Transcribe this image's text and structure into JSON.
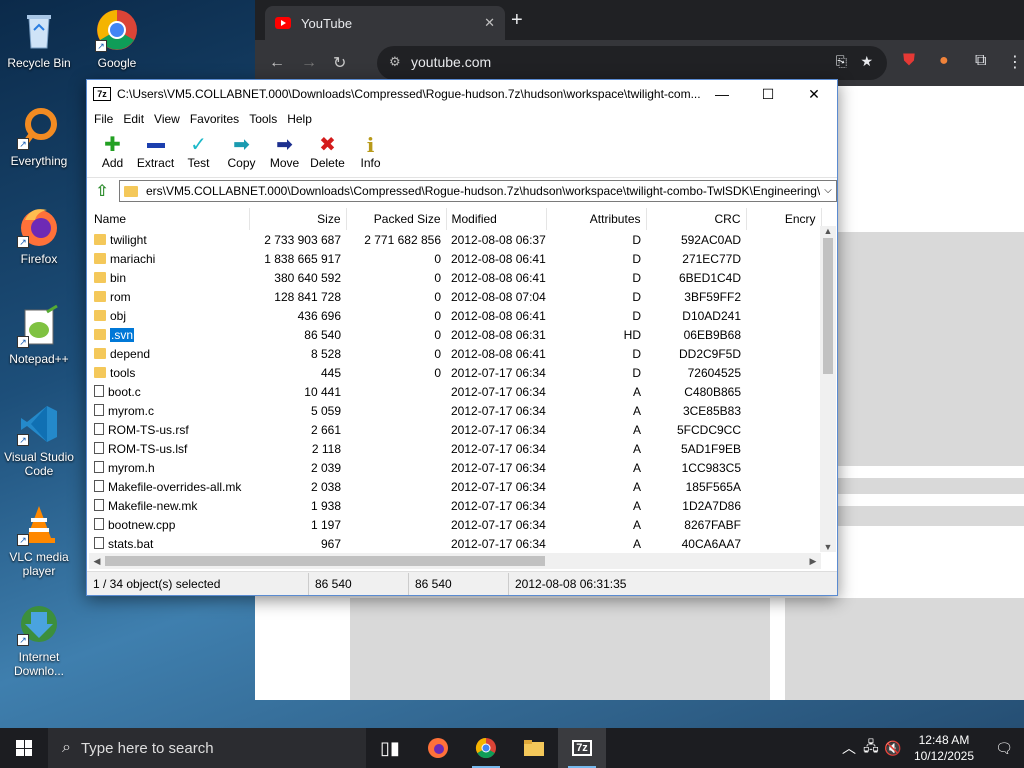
{
  "desktop": {
    "icons": [
      {
        "label": "Recycle Bin",
        "icon": "recycle-bin-icon"
      },
      {
        "label": "Google",
        "icon": "chrome-icon"
      },
      {
        "label": "Everything",
        "icon": "search-icon"
      },
      {
        "label": "Firefox",
        "icon": "firefox-icon"
      },
      {
        "label": "Notepad++",
        "icon": "notepad-icon"
      },
      {
        "label": "Visual Studio Code",
        "icon": "vscode-icon"
      },
      {
        "label": "VLC media player",
        "icon": "vlc-icon"
      },
      {
        "label": "Internet Downlo...",
        "icon": "idm-icon"
      }
    ]
  },
  "browser": {
    "tab_title": "YouTube",
    "url": "youtube.com"
  },
  "window": {
    "app_icon_text": "7z",
    "title": "C:\\Users\\VM5.COLLABNET.000\\Downloads\\Compressed\\Rogue-hudson.7z\\hudson\\workspace\\twilight-com...",
    "menu": [
      "File",
      "Edit",
      "View",
      "Favorites",
      "Tools",
      "Help"
    ],
    "toolbar": [
      "Add",
      "Extract",
      "Test",
      "Copy",
      "Move",
      "Delete",
      "Info"
    ],
    "path": "ers\\VM5.COLLABNET.000\\Downloads\\Compressed\\Rogue-hudson.7z\\hudson\\workspace\\twilight-combo-TwlSDK\\Engineering\\",
    "columns": [
      "Name",
      "Size",
      "Packed Size",
      "Modified",
      "Attributes",
      "CRC",
      "Encry"
    ],
    "rows": [
      {
        "type": "folder",
        "name": "twilight",
        "size": "2 733 903 687",
        "packed": "2 771 682 856",
        "modified": "2012-08-08 06:37",
        "attr": "D",
        "crc": "592AC0AD"
      },
      {
        "type": "folder",
        "name": "mariachi",
        "size": "1 838 665 917",
        "packed": "0",
        "modified": "2012-08-08 06:41",
        "attr": "D",
        "crc": "271EC77D"
      },
      {
        "type": "folder",
        "name": "bin",
        "size": "380 640 592",
        "packed": "0",
        "modified": "2012-08-08 06:41",
        "attr": "D",
        "crc": "6BED1C4D"
      },
      {
        "type": "folder",
        "name": "rom",
        "size": "128 841 728",
        "packed": "0",
        "modified": "2012-08-08 07:04",
        "attr": "D",
        "crc": "3BF59FF2"
      },
      {
        "type": "folder",
        "name": "obj",
        "size": "436 696",
        "packed": "0",
        "modified": "2012-08-08 06:41",
        "attr": "D",
        "crc": "D10AD241"
      },
      {
        "type": "folder",
        "name": ".svn",
        "size": "86 540",
        "packed": "0",
        "modified": "2012-08-08 06:31",
        "attr": "HD",
        "crc": "06EB9B68",
        "selected": true
      },
      {
        "type": "folder",
        "name": "depend",
        "size": "8 528",
        "packed": "0",
        "modified": "2012-08-08 06:41",
        "attr": "D",
        "crc": "DD2C9F5D"
      },
      {
        "type": "folder",
        "name": "tools",
        "size": "445",
        "packed": "0",
        "modified": "2012-07-17 06:34",
        "attr": "D",
        "crc": "72604525"
      },
      {
        "type": "file",
        "name": "boot.c",
        "size": "10 441",
        "packed": "",
        "modified": "2012-07-17 06:34",
        "attr": "A",
        "crc": "C480B865"
      },
      {
        "type": "file",
        "name": "myrom.c",
        "size": "5 059",
        "packed": "",
        "modified": "2012-07-17 06:34",
        "attr": "A",
        "crc": "3CE85B83"
      },
      {
        "type": "file",
        "name": "ROM-TS-us.rsf",
        "size": "2 661",
        "packed": "",
        "modified": "2012-07-17 06:34",
        "attr": "A",
        "crc": "5FCDC9CC"
      },
      {
        "type": "file",
        "name": "ROM-TS-us.lsf",
        "size": "2 118",
        "packed": "",
        "modified": "2012-07-17 06:34",
        "attr": "A",
        "crc": "5AD1F9EB"
      },
      {
        "type": "file",
        "name": "myrom.h",
        "size": "2 039",
        "packed": "",
        "modified": "2012-07-17 06:34",
        "attr": "A",
        "crc": "1CC983C5"
      },
      {
        "type": "file",
        "name": "Makefile-overrides-all.mk",
        "size": "2 038",
        "packed": "",
        "modified": "2012-07-17 06:34",
        "attr": "A",
        "crc": "185F565A"
      },
      {
        "type": "file",
        "name": "Makefile-new.mk",
        "size": "1 938",
        "packed": "",
        "modified": "2012-07-17 06:34",
        "attr": "A",
        "crc": "1D2A7D86"
      },
      {
        "type": "file",
        "name": "bootnew.cpp",
        "size": "1 197",
        "packed": "",
        "modified": "2012-07-17 06:34",
        "attr": "A",
        "crc": "8267FABF"
      },
      {
        "type": "file",
        "name": "stats.bat",
        "size": "967",
        "packed": "",
        "modified": "2012-07-17 06:34",
        "attr": "A",
        "crc": "40CA6AA7"
      }
    ],
    "status": {
      "selection": "1 / 34 object(s) selected",
      "size": "86 540",
      "packed": "86 540",
      "modified": "2012-08-08 06:31:35"
    }
  },
  "taskbar": {
    "search_placeholder": "Type here to search",
    "time": "12:48 AM",
    "date": "10/12/2025"
  },
  "colors": {
    "selection": "#0078d7",
    "folder": "#f4c85a",
    "taskbar": "#1c1d21"
  }
}
